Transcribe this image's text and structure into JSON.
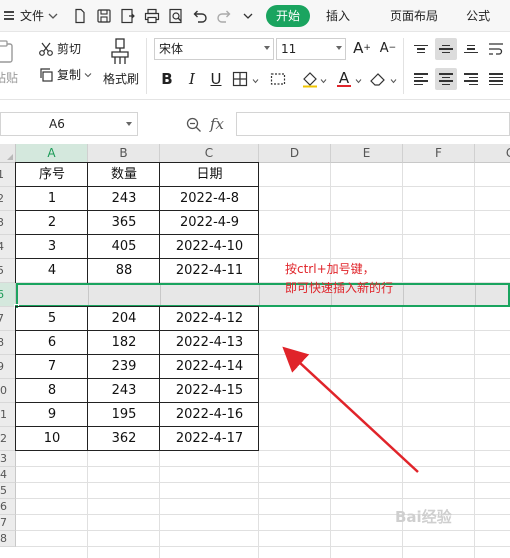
{
  "menubar": {
    "file_label": "文件",
    "tabs": [
      "开始",
      "插入",
      "页面布局",
      "公式"
    ]
  },
  "ribbon": {
    "paste_label": "粘贴",
    "cut_label": "剪切",
    "copy_label": "复制",
    "format_painter_label": "格式刷",
    "font_name": "宋体",
    "font_size": "11",
    "bold": "B",
    "italic": "I",
    "underline": "U",
    "font_color_glyph": "A",
    "grow_font": "A⁺",
    "shrink_font": "A⁻"
  },
  "formula_bar": {
    "cell_ref": "A6",
    "fx": "fx",
    "content": ""
  },
  "grid": {
    "columns": [
      "A",
      "B",
      "C",
      "D",
      "E",
      "F",
      "G"
    ],
    "rows": [
      "1",
      "2",
      "3",
      "4",
      "5",
      "6",
      "7",
      "8",
      "9",
      "10",
      "11",
      "12",
      "13",
      "14",
      "15",
      "16",
      "17",
      "18"
    ],
    "selected_row": "6",
    "selected_column": "A",
    "table": {
      "headers": [
        "序号",
        "数量",
        "日期"
      ],
      "rows": [
        [
          "1",
          "243",
          "2022-4-8"
        ],
        [
          "2",
          "365",
          "2022-4-9"
        ],
        [
          "3",
          "405",
          "2022-4-10"
        ],
        [
          "4",
          "88",
          "2022-4-11"
        ],
        [
          "",
          "",
          ""
        ],
        [
          "5",
          "204",
          "2022-4-12"
        ],
        [
          "6",
          "182",
          "2022-4-13"
        ],
        [
          "7",
          "239",
          "2022-4-14"
        ],
        [
          "8",
          "243",
          "2022-4-15"
        ],
        [
          "9",
          "195",
          "2022-4-16"
        ],
        [
          "10",
          "362",
          "2022-4-17"
        ]
      ]
    }
  },
  "annotation": {
    "line1": "按ctrl+加号键，",
    "line2": "即可快速插入新的行",
    "color": "#e0242a"
  },
  "watermark": "Bai经验",
  "colors": {
    "accent": "#1aa45f",
    "annotation": "#e0242a"
  }
}
